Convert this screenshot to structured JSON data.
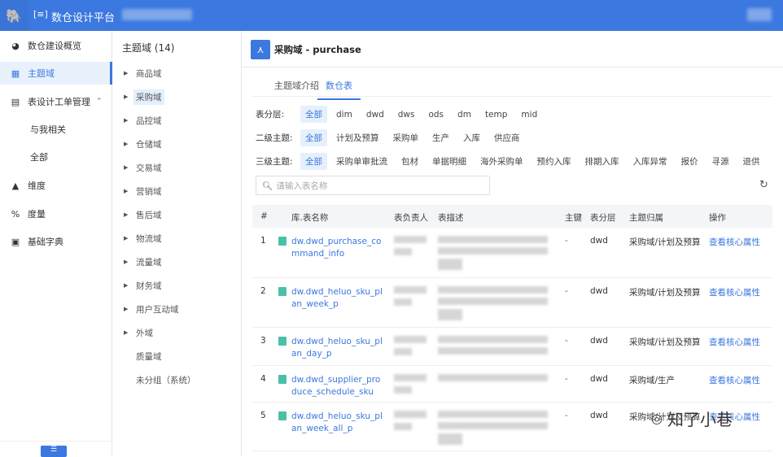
{
  "header": {
    "app_title": "数仓设计平台",
    "logo_icon": "elephant-icon"
  },
  "sidebar": {
    "items": [
      {
        "label": "数仓建设概览",
        "icon": "dashboard-icon"
      },
      {
        "label": "主题域",
        "icon": "grid-icon",
        "active": true
      },
      {
        "label": "表设计工单管理",
        "icon": "table-icon",
        "expanded": true
      },
      {
        "label": "与我相关",
        "sub": true
      },
      {
        "label": "全部",
        "sub": true
      },
      {
        "label": "维度",
        "icon": "dimension-icon"
      },
      {
        "label": "度量",
        "icon": "measure-icon"
      },
      {
        "label": "基础字典",
        "icon": "book-icon"
      }
    ],
    "collapse_label": "☰"
  },
  "tree": {
    "title": "主题域 (14)",
    "items": [
      {
        "label": "商品域",
        "arrow": true
      },
      {
        "label": "采购域",
        "arrow": true,
        "active": true
      },
      {
        "label": "品控域",
        "arrow": true
      },
      {
        "label": "仓储域",
        "arrow": true
      },
      {
        "label": "交易域",
        "arrow": true
      },
      {
        "label": "营销域",
        "arrow": true
      },
      {
        "label": "售后域",
        "arrow": true
      },
      {
        "label": "物流域",
        "arrow": true
      },
      {
        "label": "流量域",
        "arrow": true
      },
      {
        "label": "财务域",
        "arrow": true
      },
      {
        "label": "用户互动域",
        "arrow": true
      },
      {
        "label": "外域",
        "arrow": true
      },
      {
        "label": "质量域",
        "arrow": false
      },
      {
        "label": "未分组（系统）",
        "arrow": false
      }
    ]
  },
  "main": {
    "title": "采购域 - purchase",
    "tabs": [
      {
        "label": "主题域介绍"
      },
      {
        "label": "数仓表",
        "active": true
      }
    ],
    "filters": [
      {
        "label": "表分层:",
        "options": [
          "全部",
          "dim",
          "dwd",
          "dws",
          "ods",
          "dm",
          "temp",
          "mid"
        ]
      },
      {
        "label": "二级主题:",
        "options": [
          "全部",
          "计划及预算",
          "采购单",
          "生产",
          "入库",
          "供应商"
        ]
      },
      {
        "label": "三级主题:",
        "options": [
          "全部",
          "采购单审批流",
          "包材",
          "单据明细",
          "海外采购单",
          "预约入库",
          "排期入库",
          "入库异常",
          "报价",
          "寻源",
          "退供"
        ]
      }
    ],
    "search_placeholder": "请输入表名称",
    "table": {
      "columns": [
        "#",
        "库.表名称",
        "表负责人",
        "表描述",
        "主键",
        "表分层",
        "主题归属",
        "操作"
      ],
      "rows": [
        {
          "num": "1",
          "name": "dw.dwd_purchase_command_info",
          "pk": "-",
          "layer": "dwd",
          "domain": "采购域/计划及预算",
          "action": "查看核心属性"
        },
        {
          "num": "2",
          "name": "dw.dwd_heluo_sku_plan_week_p",
          "pk": "-",
          "layer": "dwd",
          "domain": "采购域/计划及预算",
          "action": "查看核心属性"
        },
        {
          "num": "3",
          "name": "dw.dwd_heluo_sku_plan_day_p",
          "pk": "-",
          "layer": "dwd",
          "domain": "采购域/计划及预算",
          "action": "查看核心属性"
        },
        {
          "num": "4",
          "name": "dw.dwd_supplier_produce_schedule_sku",
          "pk": "-",
          "layer": "dwd",
          "domain": "采购域/生产",
          "action": "查看核心属性"
        },
        {
          "num": "5",
          "name": "dw.dwd_heluo_sku_plan_week_all_p",
          "pk": "-",
          "layer": "dwd",
          "domain": "采购域/计划及预算",
          "action": "查看核心属性"
        }
      ]
    }
  },
  "watermark": "知了小巷",
  "colors": {
    "primary": "#3b78df",
    "active_bg": "#e8f1fc"
  }
}
